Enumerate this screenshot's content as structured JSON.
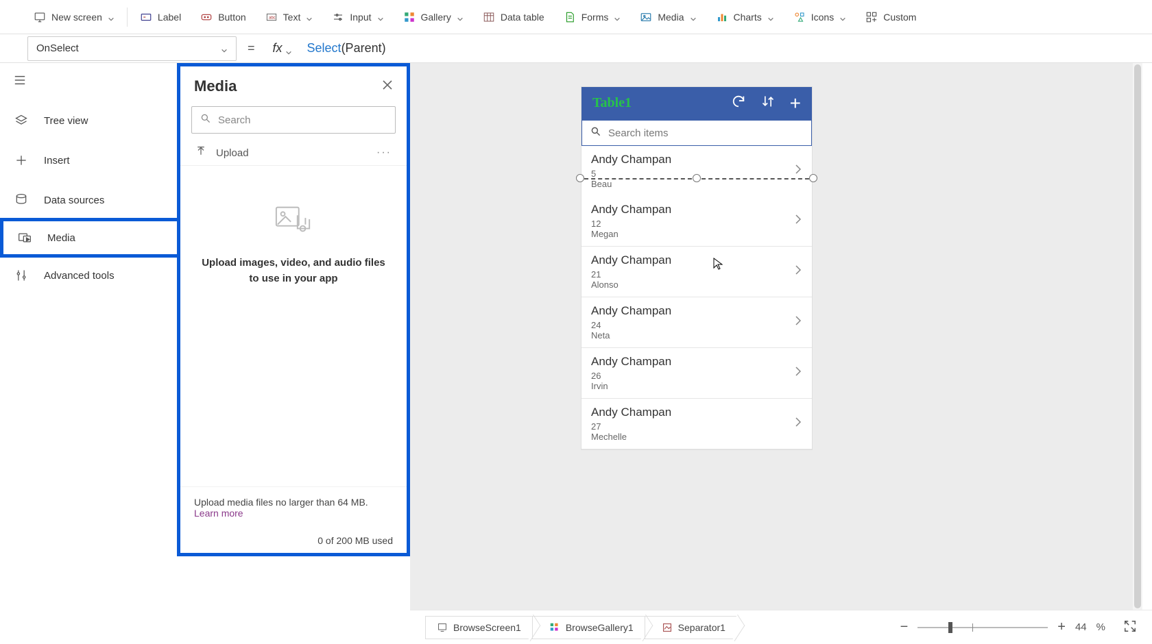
{
  "toolbar": {
    "newScreen": "New screen",
    "label": "Label",
    "button": "Button",
    "text": "Text",
    "input": "Input",
    "gallery": "Gallery",
    "dataTable": "Data table",
    "forms": "Forms",
    "media": "Media",
    "charts": "Charts",
    "icons": "Icons",
    "custom": "Custom"
  },
  "formula": {
    "property": "OnSelect",
    "fxSymbol": "fx",
    "fn": "Select",
    "arg": "(Parent)"
  },
  "leftRail": {
    "items": [
      "Tree view",
      "Insert",
      "Data sources",
      "Media",
      "Advanced tools"
    ]
  },
  "mediaPanel": {
    "title": "Media",
    "searchPlaceholder": "Search",
    "upload": "Upload",
    "emptyText": "Upload images, video, and audio files to use in your app",
    "footerText": "Upload media files no larger than 64 MB.",
    "learnMore": "Learn more",
    "usage": "0 of 200 MB used"
  },
  "phone": {
    "title": "Table1",
    "searchPlaceholder": "Search items",
    "rows": [
      {
        "name": "Andy Champan",
        "line2": "5",
        "line3": "Beau"
      },
      {
        "name": "Andy Champan",
        "line2": "12",
        "line3": "Megan"
      },
      {
        "name": "Andy Champan",
        "line2": "21",
        "line3": "Alonso"
      },
      {
        "name": "Andy Champan",
        "line2": "24",
        "line3": "Neta"
      },
      {
        "name": "Andy Champan",
        "line2": "26",
        "line3": "Irvin"
      },
      {
        "name": "Andy Champan",
        "line2": "27",
        "line3": "Mechelle"
      }
    ]
  },
  "breadcrumbs": [
    "BrowseScreen1",
    "BrowseGallery1",
    "Separator1"
  ],
  "zoom": {
    "value": "44",
    "pct": "%"
  }
}
